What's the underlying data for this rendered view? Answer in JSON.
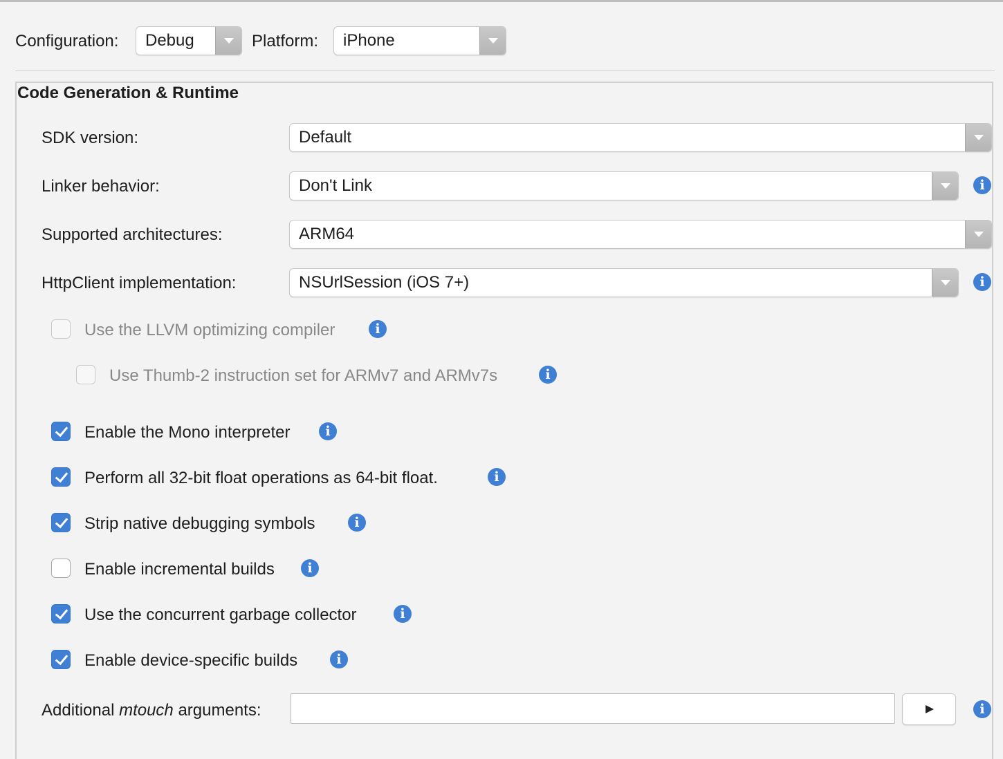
{
  "header": {
    "configuration_label": "Configuration:",
    "configuration_value": "Debug",
    "platform_label": "Platform:",
    "platform_value": "iPhone"
  },
  "section": {
    "title": "Code Generation & Runtime"
  },
  "fields": {
    "sdk_label": "SDK version:",
    "sdk_value": "Default",
    "linker_label": "Linker behavior:",
    "linker_value": "Don't Link",
    "arch_label": "Supported architectures:",
    "arch_value": "ARM64",
    "http_label": "HttpClient implementation:",
    "http_value": "NSUrlSession (iOS 7+)"
  },
  "options": {
    "llvm": {
      "label": "Use the LLVM optimizing compiler",
      "checked": false,
      "enabled": false
    },
    "thumb2": {
      "label": "Use Thumb-2 instruction set for ARMv7 and ARMv7s",
      "checked": false,
      "enabled": false
    },
    "interpreter": {
      "label": "Enable the Mono interpreter",
      "checked": true,
      "enabled": true
    },
    "float64": {
      "label": "Perform all 32-bit float operations as 64-bit float.",
      "checked": true,
      "enabled": true
    },
    "strip": {
      "label": "Strip native debugging symbols",
      "checked": true,
      "enabled": true
    },
    "incremental": {
      "label": "Enable incremental builds",
      "checked": false,
      "enabled": true
    },
    "concurrent_gc": {
      "label": "Use the concurrent garbage collector",
      "checked": true,
      "enabled": true
    },
    "device_specific": {
      "label": "Enable device-specific builds",
      "checked": true,
      "enabled": true
    }
  },
  "mtouch": {
    "label_prefix": "Additional ",
    "label_emphasis": "mtouch",
    "label_suffix": " arguments:",
    "value": ""
  },
  "icons": {
    "info_glyph": "i",
    "info": "info-icon",
    "dropdown": "chevron-down-icon",
    "run": "play-icon"
  },
  "colors": {
    "accent": "#3f7fd4",
    "background": "#f3f3f3"
  }
}
